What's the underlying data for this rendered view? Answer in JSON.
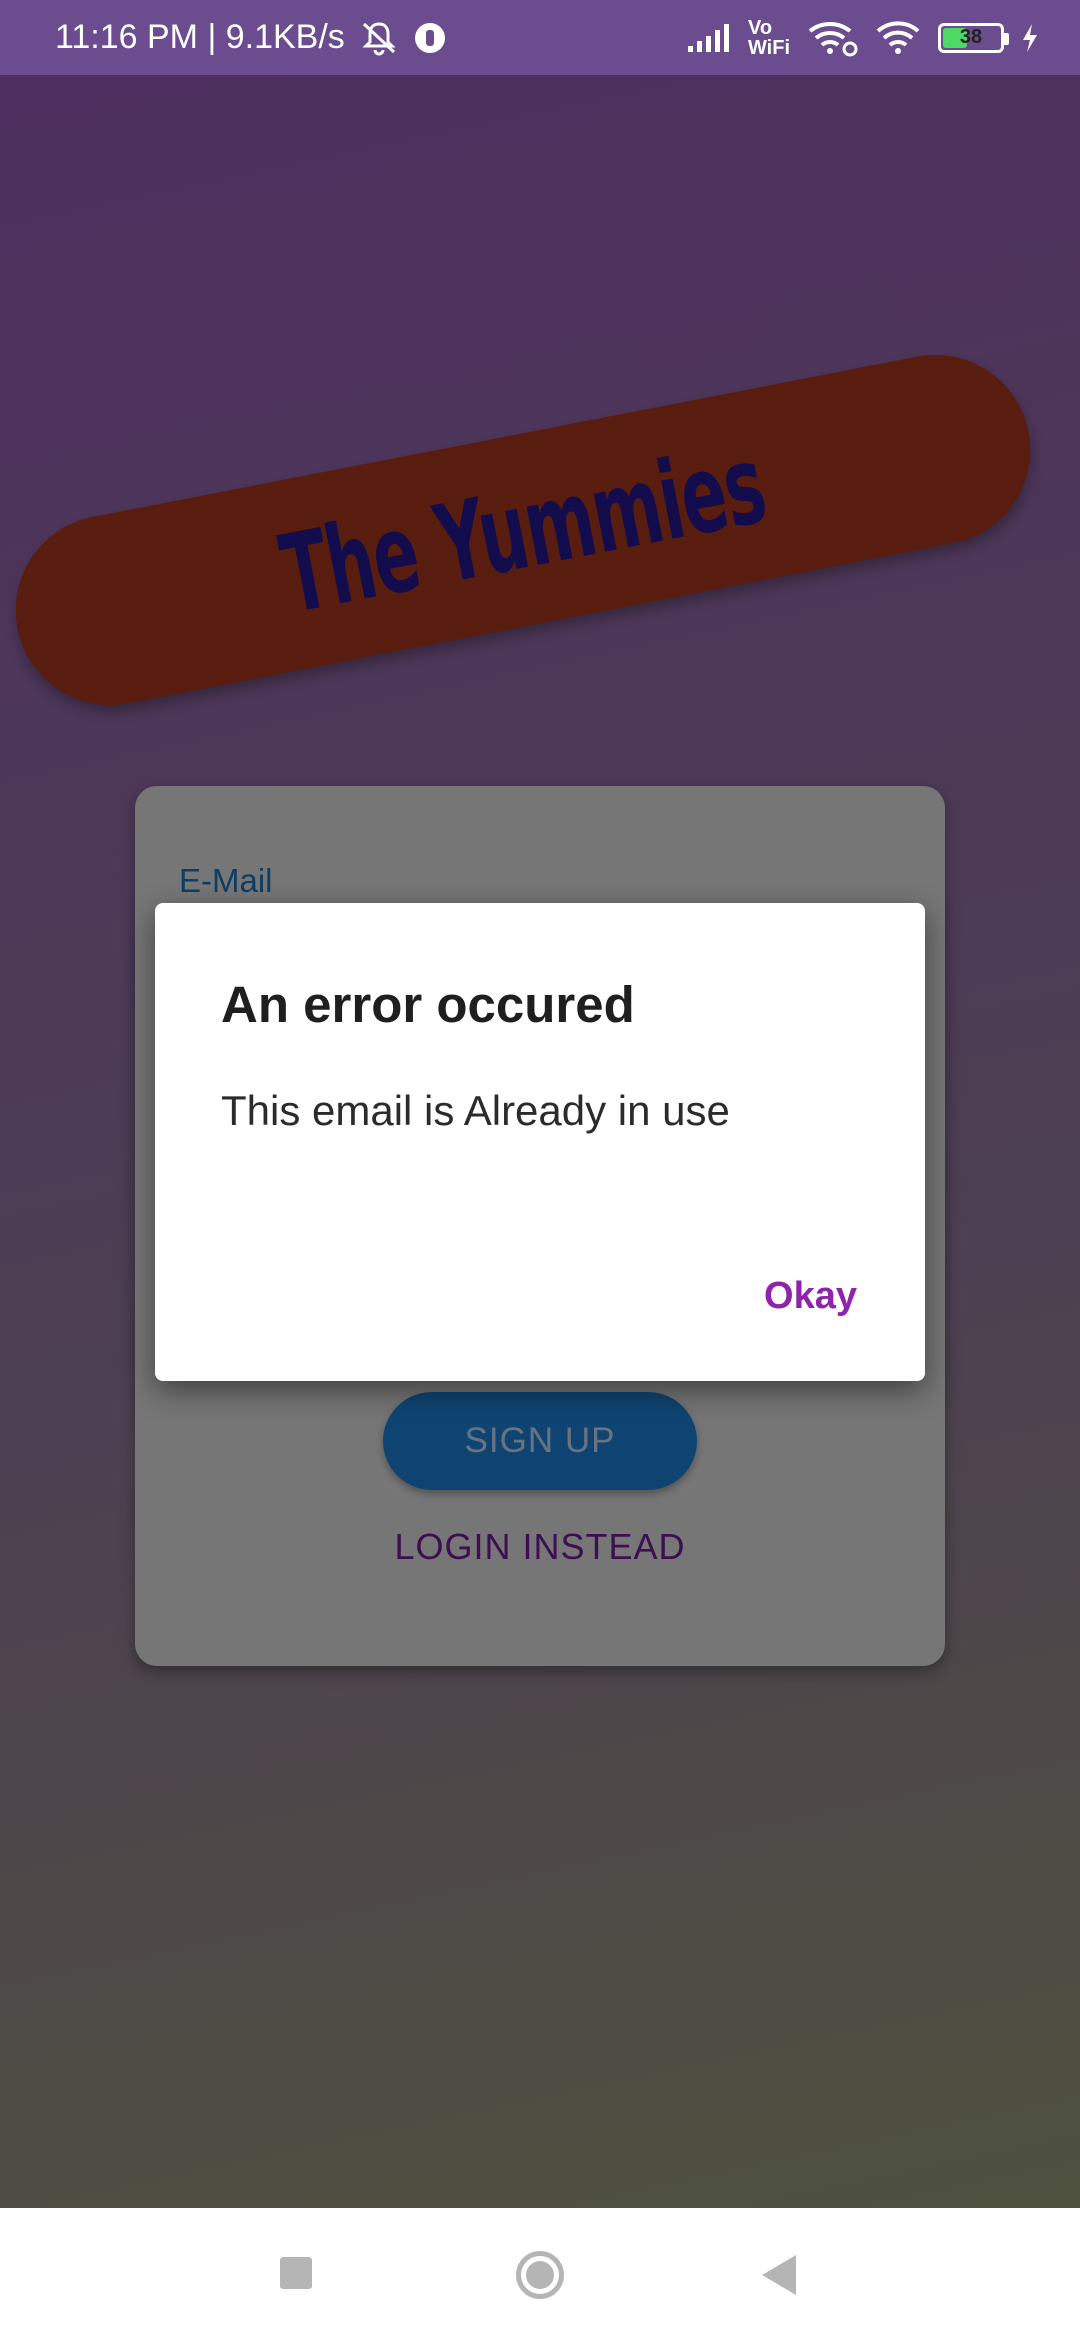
{
  "status_bar": {
    "time_speed": "11:16 PM | 9.1KB/s",
    "vo_label": "Vo",
    "wifi_label": "WiFi",
    "battery_level": "38",
    "icons": [
      "mute-bell-icon",
      "vpn-icon",
      "signal-icon",
      "wifi-call-icon",
      "wifi-icon",
      "battery-icon",
      "charging-icon"
    ]
  },
  "app": {
    "banner_title": "The Yummies",
    "form": {
      "email_label": "E-Mail",
      "signup_button": "SIGN UP",
      "login_link": "LOGIN INSTEAD"
    }
  },
  "dialog": {
    "title": "An error occured",
    "message": "This email is Already in use",
    "action": "Okay"
  },
  "nav_bar": {
    "icons": [
      "recents-square-icon",
      "home-circle-icon",
      "back-triangle-icon"
    ]
  },
  "colors": {
    "banner": "#b03a1e",
    "banner_text": "#241799",
    "signup_button": "#1e88e5",
    "dialog_action": "#8e24aa"
  }
}
